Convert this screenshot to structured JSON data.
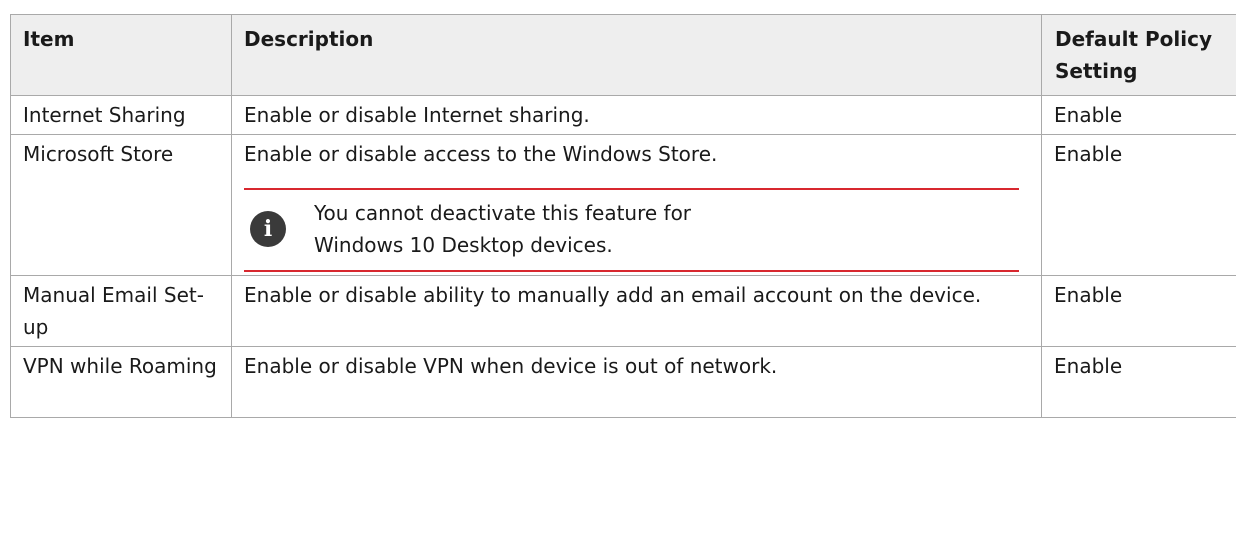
{
  "table": {
    "headers": {
      "item": "Item",
      "description": "Description",
      "default": "Default Policy Setting"
    },
    "rows": [
      {
        "item": "Internet Sharing",
        "description": "Enable or disable Internet sharing.",
        "default": "Enable"
      },
      {
        "item": "Microsoft Store",
        "description": "Enable or disable access to the Windows Store.",
        "note": "You cannot deactivate this feature for Windows 10 Desktop devices.",
        "note_icon": "info-icon",
        "default": "Enable"
      },
      {
        "item": "Manual Email Set-up",
        "description": "Enable or disable ability to manually add an email account on the device.",
        "default": "Enable"
      },
      {
        "item": "VPN while Roaming",
        "description": "Enable or disable VPN when device is out of network.",
        "default": "Enable"
      }
    ]
  },
  "colors": {
    "header_bg": "#eeeeee",
    "border": "#a9a9a9",
    "note_rule": "#d8282f",
    "icon_bg": "#3a3a3a"
  }
}
